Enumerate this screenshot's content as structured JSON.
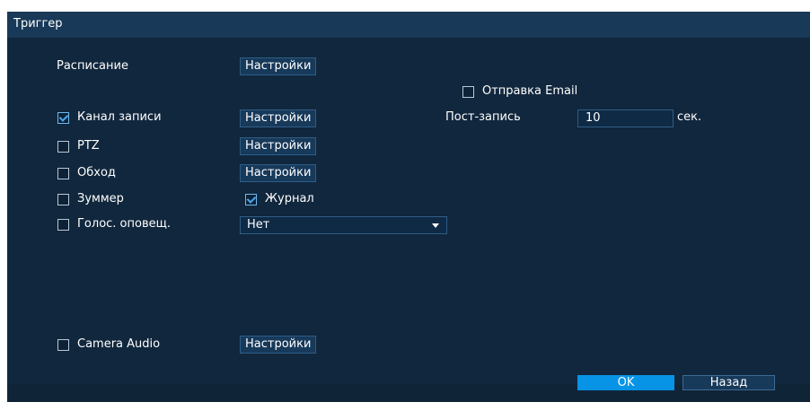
{
  "window": {
    "title": "Триггер"
  },
  "schedule": {
    "label": "Расписание",
    "button": "Настройки"
  },
  "email": {
    "label": "Отправка Email",
    "checked": false
  },
  "record_channel": {
    "label": "Канал записи",
    "checked": true,
    "button": "Настройки"
  },
  "post_record": {
    "label": "Пост-запись",
    "value": "10",
    "unit": "сек."
  },
  "ptz": {
    "label": "PTZ",
    "checked": false,
    "button": "Настройки"
  },
  "tour": {
    "label": "Обход",
    "checked": false,
    "button": "Настройки"
  },
  "buzzer": {
    "label": "Зуммер",
    "checked": false
  },
  "log": {
    "label": "Журнал",
    "checked": true
  },
  "voice_alert": {
    "label": "Голос. оповещ.",
    "checked": false,
    "selected": "Нет"
  },
  "camera_audio": {
    "label": "Camera Audio",
    "checked": false,
    "button": "Настройки"
  },
  "footer": {
    "ok": "OK",
    "back": "Назад"
  }
}
